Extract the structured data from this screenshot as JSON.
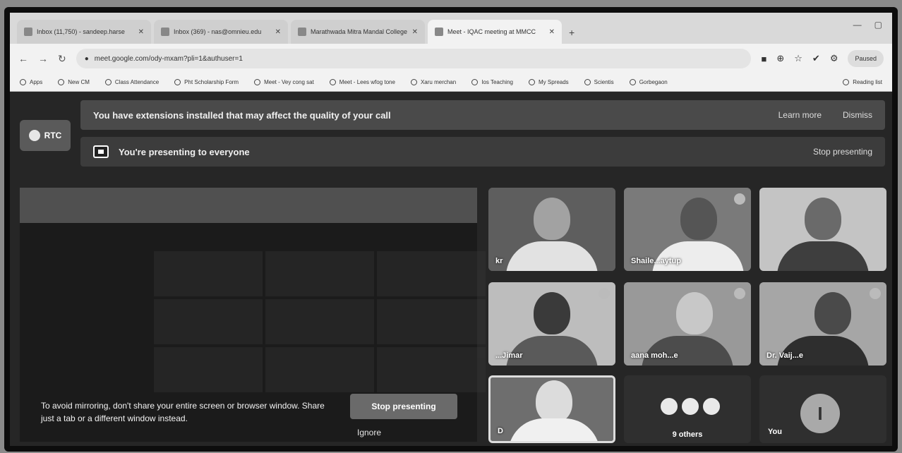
{
  "browser": {
    "tabs": [
      {
        "label": "Inbox (11,750) - sandeep.harse"
      },
      {
        "label": "Inbox (369) - nas@omnieu.edu"
      },
      {
        "label": "Marathwada Mitra Mandal College"
      },
      {
        "label": "Meet - IQAC meeting at MMCC"
      }
    ],
    "new_tab": "+",
    "url": "meet.google.com/ody-mxam?pli=1&authuser=1",
    "profile": "Paused",
    "bookmarks": [
      "Apps",
      "New CM",
      "Class Attendance",
      "Pht Scholarship Form",
      "Meet - Vey cong sat",
      "Meet - Lees wfog tone",
      "Xaru merchan",
      "Ios Teaching",
      "My Spreads",
      "Scientis",
      "Gorbegaon"
    ],
    "reading_list": "Reading list"
  },
  "rtc": {
    "label": "RTC"
  },
  "banners": {
    "extensions": {
      "text": "You have extensions installed that may affect the quality of your call",
      "learn_more": "Learn more",
      "dismiss": "Dismiss"
    },
    "presenting": {
      "text": "You're presenting to everyone",
      "stop": "Stop presenting"
    }
  },
  "present": {
    "hint": "To avoid mirroring, don't share your entire screen or browser window. Share just a tab or a different window instead.",
    "stop_button": "Stop presenting",
    "ignore": "Ignore"
  },
  "tiles": [
    {
      "name": "kr"
    },
    {
      "name": "Shaile...aytup"
    },
    {
      "name": ""
    },
    {
      "name": "...Jimar"
    },
    {
      "name": "aana moh...e"
    },
    {
      "name": "Dr. Vaij...e"
    },
    {
      "name": "D"
    }
  ],
  "others_tile": {
    "label": "9 others"
  },
  "you_tile": {
    "label": "You",
    "initial": "I"
  }
}
